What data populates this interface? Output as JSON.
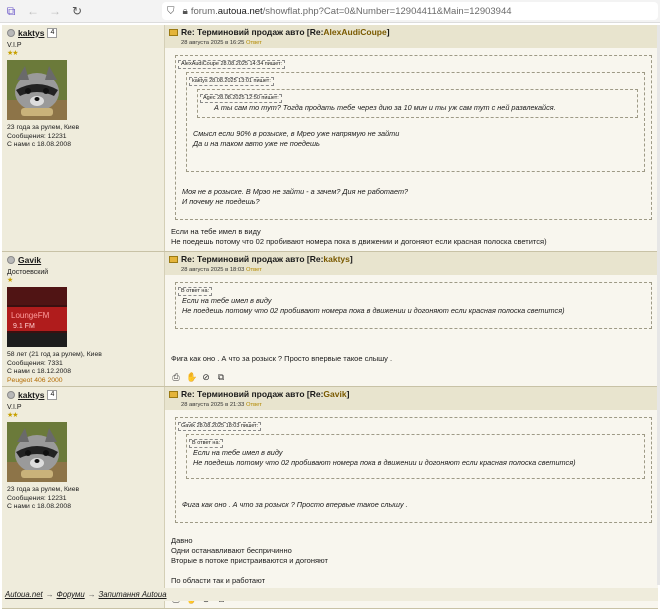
{
  "browser": {
    "url_prefix": "forum.",
    "url_domain": "autoua.net",
    "url_rest": "/showflat.php?Cat=0&Number=12904411&Main=12903944",
    "icons": [
      "new-tab-icon",
      "back-icon",
      "forward-icon",
      "reload-icon",
      "shield-icon",
      "lock-icon"
    ]
  },
  "posts": [
    {
      "username": "kaktys",
      "postcount_badge": "4",
      "status": "V.I.P",
      "stars": "★★",
      "avatar": "raccoon-avatar",
      "info_lines": [
        "23 года за рулем, Киев",
        "Сообщения: 12231",
        "С нами с 18.08.2008"
      ],
      "title_prefix": "Re: Терминовий продаж авто [Re: ",
      "title_ref": "AlexAudiCoupe",
      "title_suffix": "]",
      "date": "28 августа 2025 в 16:25",
      "date_action": "Ответ",
      "quotes_l1_head": "AlexAudiCoupe 28.08.2025 14:34 пишет:",
      "quotes_l2_head": "kaktys 28.08.2025 13:01 пишет:",
      "quotes_l3_head": "Agec 28.08.2025 12:50 пишет:",
      "quote_l3_text": "А ты сам то тут? Тогда продать тебе через дию за 10 мин и ты уж сам тут с ней развлекайся.",
      "quote_l2_text_1": "Смысл если 90% в розыске, в Мрео уже напрямую не зайти",
      "quote_l2_text_2": "Да и на таком авто уже не поедешь",
      "quote_l1_text_1": "Моя не в розыске. В Мрэо не зайти - а зачем? Дия не работает?",
      "quote_l1_text_2": "И почему не поедешь?",
      "body_1": "Если на тебе имел в виду",
      "body_2": "Не поедешь потому что 02 пробивают номера пока в движении и догоняют если красная полоска светится)"
    },
    {
      "username": "Gavik",
      "status": "Достоевский",
      "stars": "★",
      "avatar": "lounge-fm-avatar",
      "info_lines": [
        "58 лет (21 год за рулем), Киев",
        "Сообщения: 7331",
        "С нами с 18.12.2008"
      ],
      "car": "Peugeot 406 2000",
      "title_prefix": "Re: Терминовий продаж авто [Re: ",
      "title_ref": "kaktys",
      "title_suffix": "]",
      "date": "28 августа 2025 в 18:03",
      "date_action": "Ответ",
      "quote_head": "В ответ на:",
      "quote_text_1": "Если на тебе имел в виду",
      "quote_text_2": "Не поедешь потому что 02 пробивают номера пока в движении и догоняют если красная полоска светится)",
      "body_1": "Фига как оно . А что за розыск ? Просто впервые такое слышу ."
    },
    {
      "username": "kaktys",
      "postcount_badge": "4",
      "status": "V.I.P",
      "stars": "★★",
      "avatar": "raccoon-avatar",
      "info_lines": [
        "23 года за рулем, Киев",
        "Сообщения: 12231",
        "С нами с 18.08.2008"
      ],
      "title_prefix": "Re: Терминовий продаж авто [Re: ",
      "title_ref": "Gavik",
      "title_suffix": "]",
      "date": "28 августа 2025 в 21:33",
      "date_action": "Ответ",
      "quote_l1_head": "Gavik 28.08.2025 18:03 пишет:",
      "quote_l2_head": "В ответ на:",
      "quote_l2_text_1": "Если на тебе имел в виду",
      "quote_l2_text_2": "Не поедешь потому что 02 пробивают номера пока в движении и догоняют если красная полоска светится)",
      "quote_l1_text": "Фига как оно . А что за розыск ? Просто впервые такое слышу .",
      "body_1": "Давно",
      "body_2": "Одни останавливают беспричинно",
      "body_3": "Вторые в потоке пристраиваются и догоняют",
      "body_4": "По области так и работают"
    }
  ],
  "breadcrumb": {
    "site": "Autoua.net",
    "forums": "Форуми",
    "section": "Запитання Autoua",
    "sep": "→"
  }
}
